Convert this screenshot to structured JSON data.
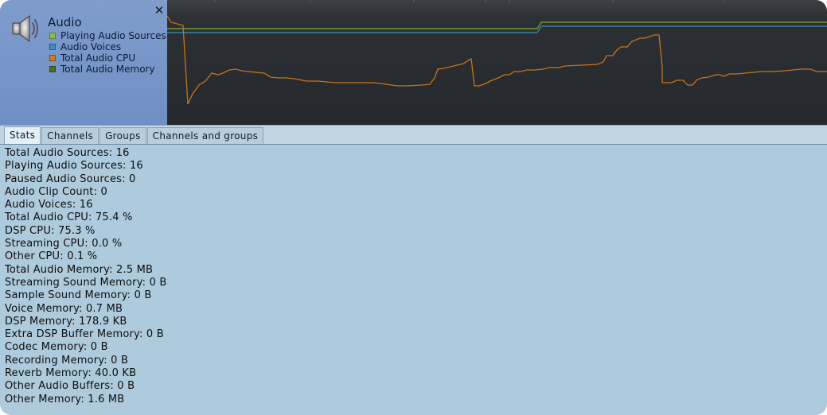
{
  "legend": {
    "title": "Audio",
    "close_icon": "close-icon",
    "speaker_icon": "speaker-icon",
    "items": [
      {
        "label": "Playing Audio Sources",
        "color": "#8fbf3f"
      },
      {
        "label": "Audio Voices",
        "color": "#3c8fbf"
      },
      {
        "label": "Total Audio CPU",
        "color": "#d07b1e"
      },
      {
        "label": "Total Audio Memory",
        "color": "#556b22"
      }
    ]
  },
  "graph": {
    "colors": {
      "sources": "#6f9a2c",
      "voices": "#3f7f9f",
      "cpu": "#c8741a",
      "memory": "#556b22"
    }
  },
  "tabs": [
    "Stats",
    "Channels",
    "Groups",
    "Channels and groups"
  ],
  "active_tab": "Stats",
  "stats": [
    "Total Audio Sources: 16",
    "Playing Audio Sources: 16",
    "Paused Audio Sources: 0",
    "Audio Clip Count: 0",
    "Audio Voices: 16",
    "Total Audio CPU: 75.4 %",
    "DSP CPU: 75.3 %",
    "Streaming CPU: 0.0 %",
    "Other CPU: 0.1 %",
    "Total Audio Memory: 2.5 MB",
    "Streaming Sound Memory: 0 B",
    "Sample Sound Memory: 0 B",
    "Voice Memory: 0.7 MB",
    "DSP Memory: 178.9 KB",
    "Extra DSP Buffer Memory: 0 B",
    "Codec Memory: 0 B",
    "Recording Memory: 0 B",
    "Reverb Memory: 40.0 KB",
    "Other Audio Buffers: 0 B",
    "Other Memory: 1.6 MB"
  ]
}
